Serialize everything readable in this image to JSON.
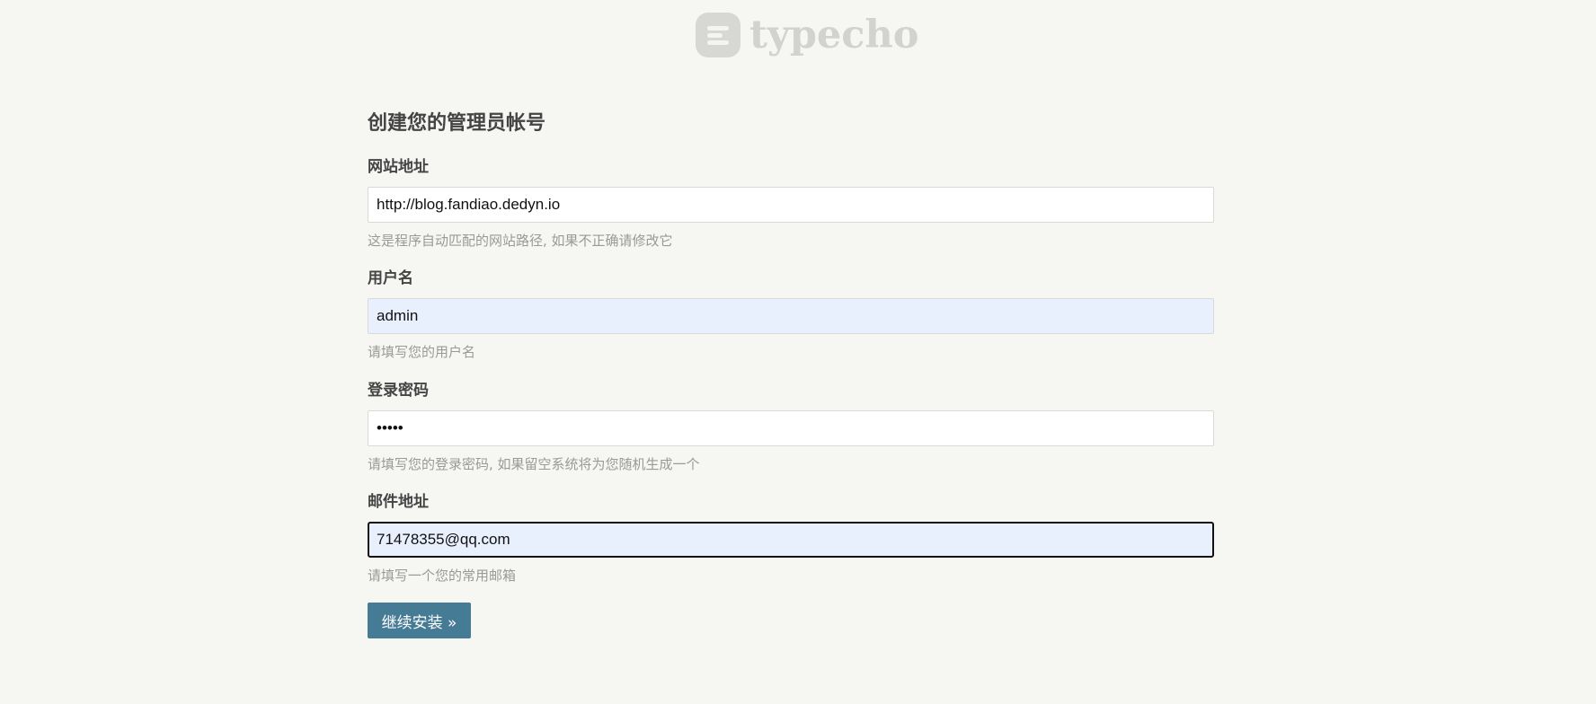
{
  "brand": {
    "logo_text": "typecho"
  },
  "form": {
    "title": "创建您的管理员帐号",
    "fields": [
      {
        "label": "网站地址",
        "value": "http://blog.fandiao.dedyn.io",
        "description": "这是程序自动匹配的网站路径, 如果不正确请修改它"
      },
      {
        "label": "用户名",
        "value": "admin",
        "description": "请填写您的用户名"
      },
      {
        "label": "登录密码",
        "value": "11111",
        "description": "请填写您的登录密码, 如果留空系统将为您随机生成一个"
      },
      {
        "label": "邮件地址",
        "value": "71478355@qq.com",
        "description": "请填写一个您的常用邮箱"
      }
    ],
    "submit_label": "继续安装 »"
  },
  "colors": {
    "background": "#f6f6f3",
    "button": "#467b96",
    "autofill": "#e8f0fe",
    "logo": "#d2d2ce"
  }
}
